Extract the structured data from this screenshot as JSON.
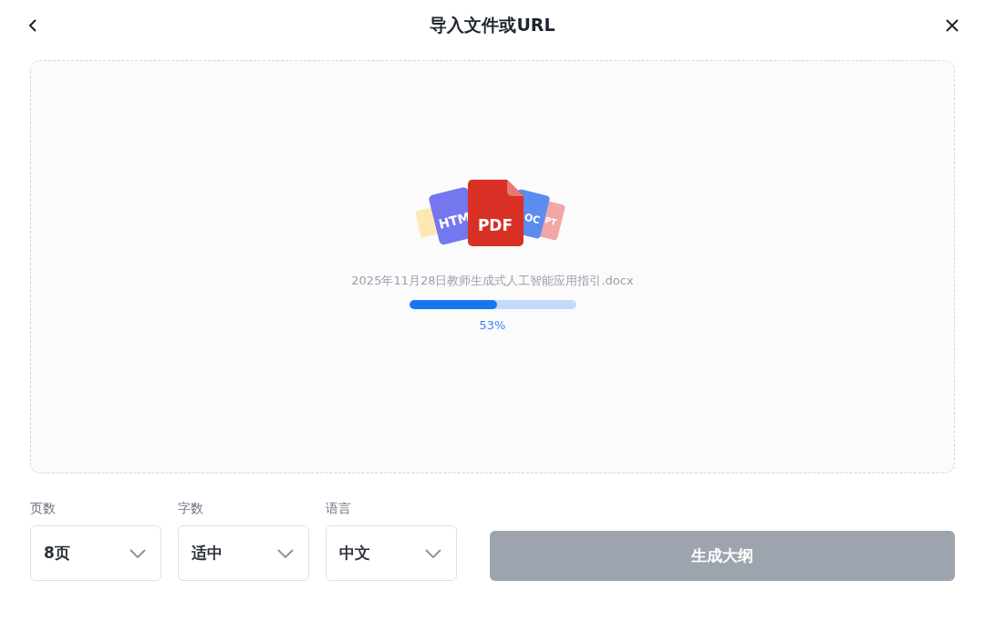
{
  "header": {
    "title": "导入文件或URL"
  },
  "upload": {
    "file_types": [
      "HTM",
      "PDF",
      "OC",
      "PT"
    ],
    "file_name": "2025年11月28日教师生成式人工智能应用指引.docx",
    "level": 0.53,
    "percent": "53%"
  },
  "options": [
    {
      "label": "页数",
      "value": "8页"
    },
    {
      "label": "字数",
      "value": "适中"
    },
    {
      "label": "语言",
      "value": "中文"
    }
  ],
  "generate_button": {
    "label": "生成大纲",
    "disabled": true
  }
}
